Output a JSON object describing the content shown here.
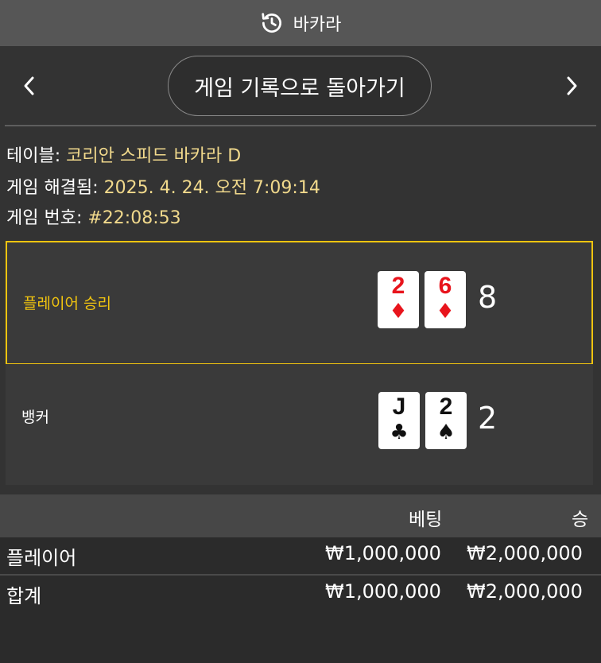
{
  "header": {
    "icon": "history-icon",
    "title": "바카라"
  },
  "nav": {
    "back_label": "게임 기록으로 돌아가기",
    "prev_icon": "chevron-left-icon",
    "next_icon": "chevron-right-icon"
  },
  "info": {
    "table_label": "테이블:",
    "table_value": "코리안 스피드 바카라 D",
    "resolved_label": "게임 해결됨:",
    "resolved_value": "2025. 4. 24. 오전 7:09:14",
    "number_label": "게임 번호:",
    "number_value": "#22:08:53"
  },
  "hands": {
    "player": {
      "label": "플레이어 승리",
      "cards": [
        {
          "rank": "2",
          "suit": "♦",
          "color": "red"
        },
        {
          "rank": "6",
          "suit": "♦",
          "color": "red"
        }
      ],
      "score": "8"
    },
    "banker": {
      "label": "뱅커",
      "cards": [
        {
          "rank": "J",
          "suit": "♣",
          "color": "black"
        },
        {
          "rank": "2",
          "suit": "♠",
          "color": "black"
        }
      ],
      "score": "2"
    }
  },
  "bets": {
    "columns": {
      "bet": "베팅",
      "win": "승"
    },
    "rows": [
      {
        "name": "플레이어",
        "bet": "₩1,000,000",
        "win": "₩2,000,000"
      },
      {
        "name": "합계",
        "bet": "₩1,000,000",
        "win": "₩2,000,000"
      }
    ]
  },
  "colors": {
    "winner_border": "#f1c40f",
    "info_value": "#f1d98c",
    "card_red": "#e8141c"
  }
}
